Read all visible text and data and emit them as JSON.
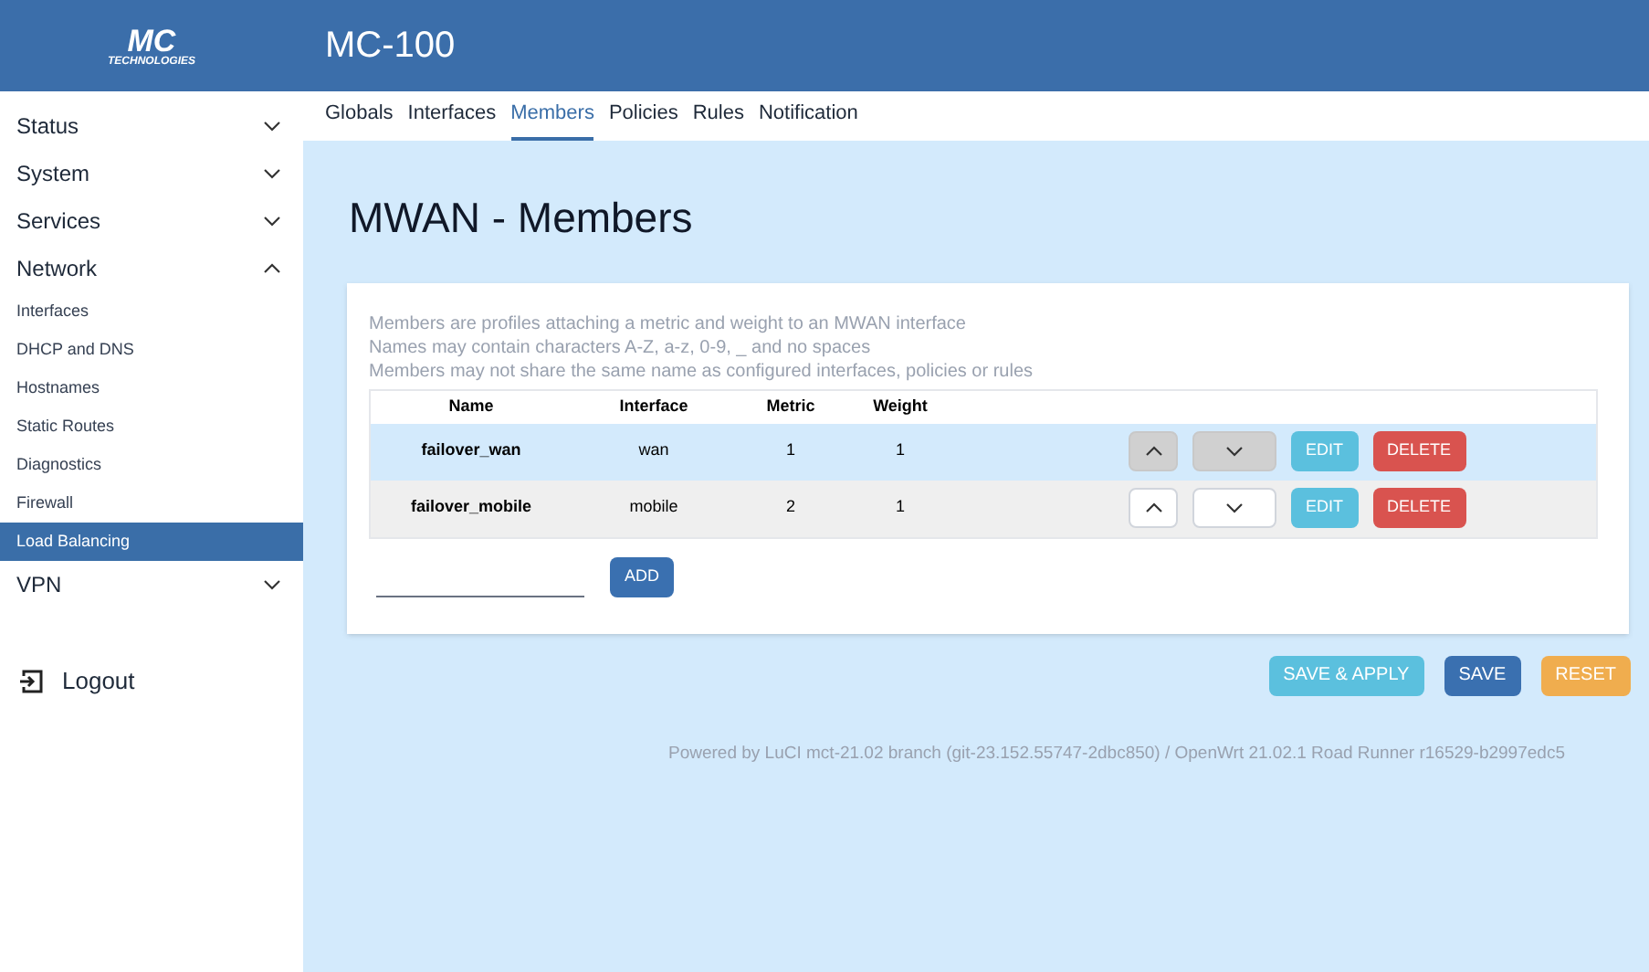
{
  "logo": {
    "mark": "MC",
    "sub": "TECHNOLOGIES"
  },
  "header": {
    "title": "MC-100"
  },
  "sidebar": {
    "items": [
      {
        "label": "Status",
        "expanded": false
      },
      {
        "label": "System",
        "expanded": false
      },
      {
        "label": "Services",
        "expanded": false
      },
      {
        "label": "Network",
        "expanded": true,
        "children": [
          {
            "label": "Interfaces",
            "selected": false
          },
          {
            "label": "DHCP and DNS",
            "selected": false
          },
          {
            "label": "Hostnames",
            "selected": false
          },
          {
            "label": "Static Routes",
            "selected": false
          },
          {
            "label": "Diagnostics",
            "selected": false
          },
          {
            "label": "Firewall",
            "selected": false
          },
          {
            "label": "Load Balancing",
            "selected": true
          }
        ]
      },
      {
        "label": "VPN",
        "expanded": false
      }
    ],
    "logout": "Logout"
  },
  "tabs": [
    {
      "label": "Globals",
      "selected": false
    },
    {
      "label": "Interfaces",
      "selected": false
    },
    {
      "label": "Members",
      "selected": true
    },
    {
      "label": "Policies",
      "selected": false
    },
    {
      "label": "Rules",
      "selected": false
    },
    {
      "label": "Notification",
      "selected": false
    }
  ],
  "page_title": "MWAN - Members",
  "description": [
    "Members are profiles attaching a metric and weight to an MWAN interface",
    "Names may contain characters A-Z, a-z, 0-9, _ and no spaces",
    "Members may not share the same name as configured interfaces, policies or rules"
  ],
  "table": {
    "columns": [
      "Name",
      "Interface",
      "Metric",
      "Weight"
    ],
    "rows": [
      {
        "cells": [
          "failover_wan",
          "wan",
          "1",
          "1"
        ],
        "selected": true,
        "edit": "EDIT",
        "delete": "DELETE"
      },
      {
        "cells": [
          "failover_mobile",
          "mobile",
          "2",
          "1"
        ],
        "selected": false,
        "edit": "EDIT",
        "delete": "DELETE"
      }
    ]
  },
  "add_button": "ADD",
  "actions": [
    "SAVE & APPLY",
    "SAVE",
    "RESET"
  ],
  "footer": "Powered by LuCI mct-21.02 branch (git-23.152.55747-2dbc850) / OpenWrt 21.02.1 Road Runner r16529-b2997edc5"
}
